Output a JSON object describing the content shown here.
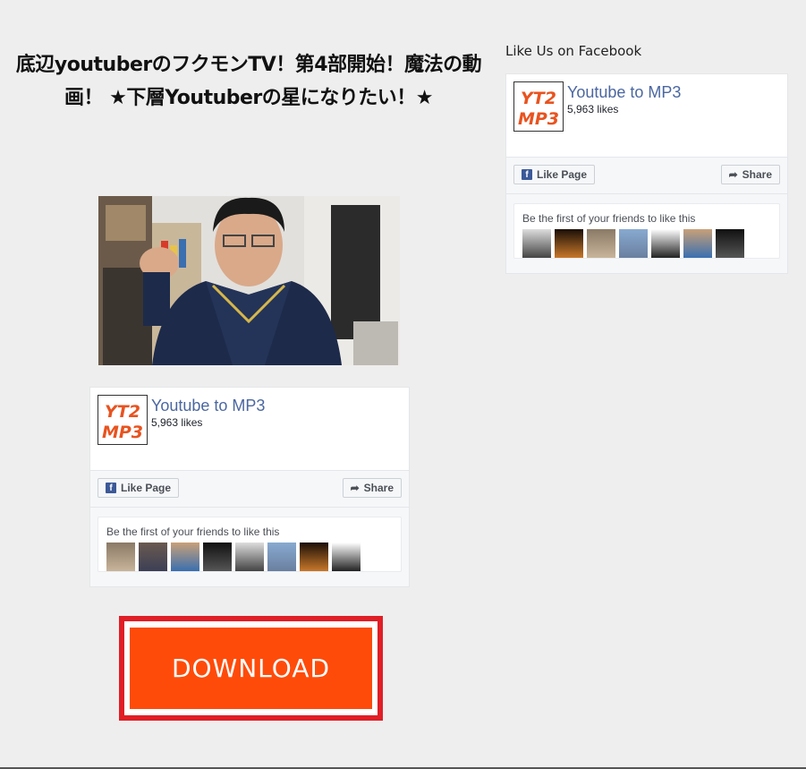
{
  "video": {
    "title": "底辺youtuberのフクモンTV！第4部開始！魔法の動画！ ★下層Youtuberの星になりたい！★"
  },
  "download": {
    "label": "DOWNLOAD",
    "button_color": "#ff4b0a",
    "frame_color": "#e01e25"
  },
  "sidebar": {
    "heading": "Like Us on Facebook"
  },
  "facebook": {
    "page_name": "Youtube to MP3",
    "likes": "5,963 likes",
    "logo_text_top": "YT2",
    "logo_text_bottom": "MP3",
    "like_button": "Like Page",
    "share_button": "Share",
    "friends_text": "Be the first of your friends to like this",
    "link_color": "#4b67a1"
  }
}
